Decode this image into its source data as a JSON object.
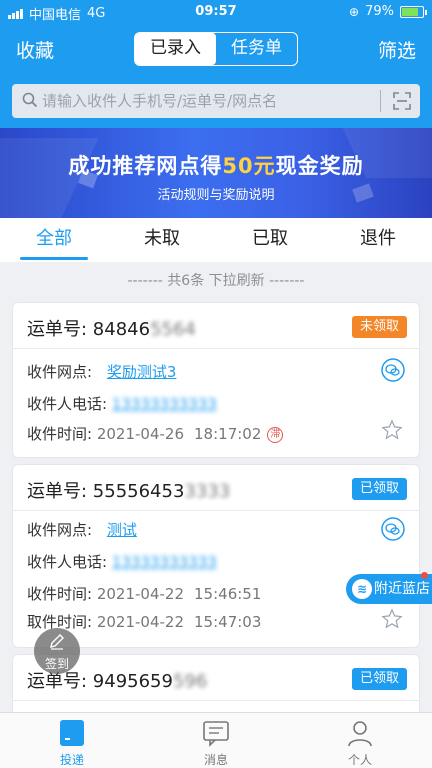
{
  "status": {
    "carrier": "中国电信",
    "network": "4G",
    "time": "09:57",
    "battery": "79%",
    "battery_level": 0.79
  },
  "header": {
    "left": "收藏",
    "seg_left": "已录入",
    "seg_right": "任务单",
    "right": "筛选"
  },
  "search": {
    "placeholder": "请输入收件人手机号/运单号/网点名"
  },
  "banner": {
    "title_prefix": "成功推荐网点得",
    "title_highlight": "50元",
    "title_suffix": "现金奖励",
    "subtitle": "活动规则与奖励说明"
  },
  "tabs": [
    "全部",
    "未取",
    "已取",
    "退件"
  ],
  "count_text": "------- 共6条  下拉刷新 -------",
  "labels": {
    "waybill": "运单号: ",
    "site": "收件网点: ",
    "phone": "收件人电话: ",
    "receive_time": "收件时间: ",
    "pickup_time": "取件时间: "
  },
  "cards": [
    {
      "waybill_visible": "84846",
      "waybill_blurred": "5564",
      "status": "未领取",
      "site": "奖励测试3",
      "phone": "13333333333",
      "receive_date": "2021-04-26",
      "receive_time": "18:17:02",
      "exp_icon": "滞"
    },
    {
      "waybill_visible": "55556453",
      "waybill_blurred": "3333",
      "status": "已领取",
      "site": "测试",
      "phone": "13333333333",
      "receive_date": "2021-04-22",
      "receive_time": "15:46:51",
      "pickup_date": "2021-04-22",
      "pickup_time": "15:47:03"
    },
    {
      "waybill_visible": "9495659",
      "waybill_blurred": "596",
      "status": "已领取"
    }
  ],
  "floating": {
    "nearby": "附近蓝店",
    "checkin": "签到"
  },
  "bottomnav": [
    "投递",
    "消息",
    "个人"
  ],
  "colors": {
    "primary": "#1e9cf0",
    "orange": "#f4862a",
    "highlight": "#ffd23f"
  }
}
